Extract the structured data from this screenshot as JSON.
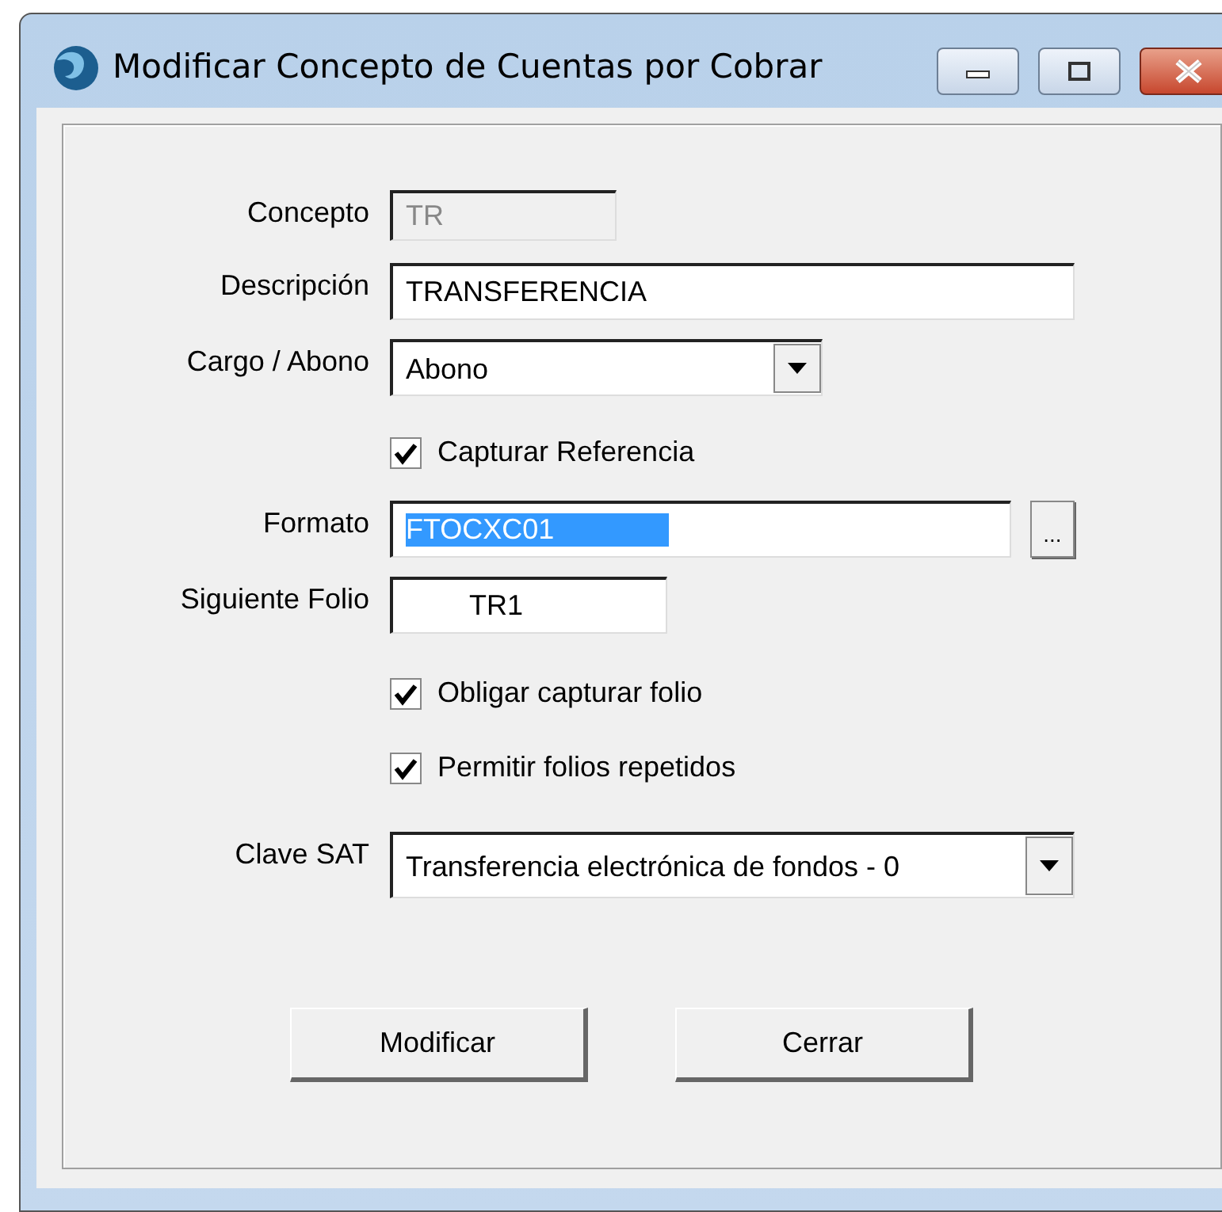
{
  "window": {
    "title": "Modificar Concepto de Cuentas por Cobrar"
  },
  "fields": [
    {
      "kind": "text",
      "label": "Concepto",
      "value": "TR",
      "disabled": true
    },
    {
      "kind": "text",
      "label": "Descripción",
      "value": "TRANSFERENCIA",
      "disabled": false
    },
    {
      "kind": "select",
      "label": "Cargo / Abono",
      "value": "Abono"
    },
    {
      "kind": "checkbox",
      "label": "Capturar Referencia",
      "checked": true
    },
    {
      "kind": "browse",
      "label": "Formato",
      "value": "FTOCXC01",
      "highlighted": true,
      "button": "..."
    },
    {
      "kind": "text",
      "label": "Siguiente Folio",
      "value": "TR1",
      "disabled": false
    },
    {
      "kind": "checkbox",
      "label": "Obligar capturar folio",
      "checked": true
    },
    {
      "kind": "checkbox",
      "label": "Permitir folios repetidos",
      "checked": true
    },
    {
      "kind": "select",
      "label": "Clave SAT",
      "value": "Transferencia electrónica de fondos - 0"
    }
  ],
  "buttons": [
    "Modificar",
    "Cerrar"
  ]
}
